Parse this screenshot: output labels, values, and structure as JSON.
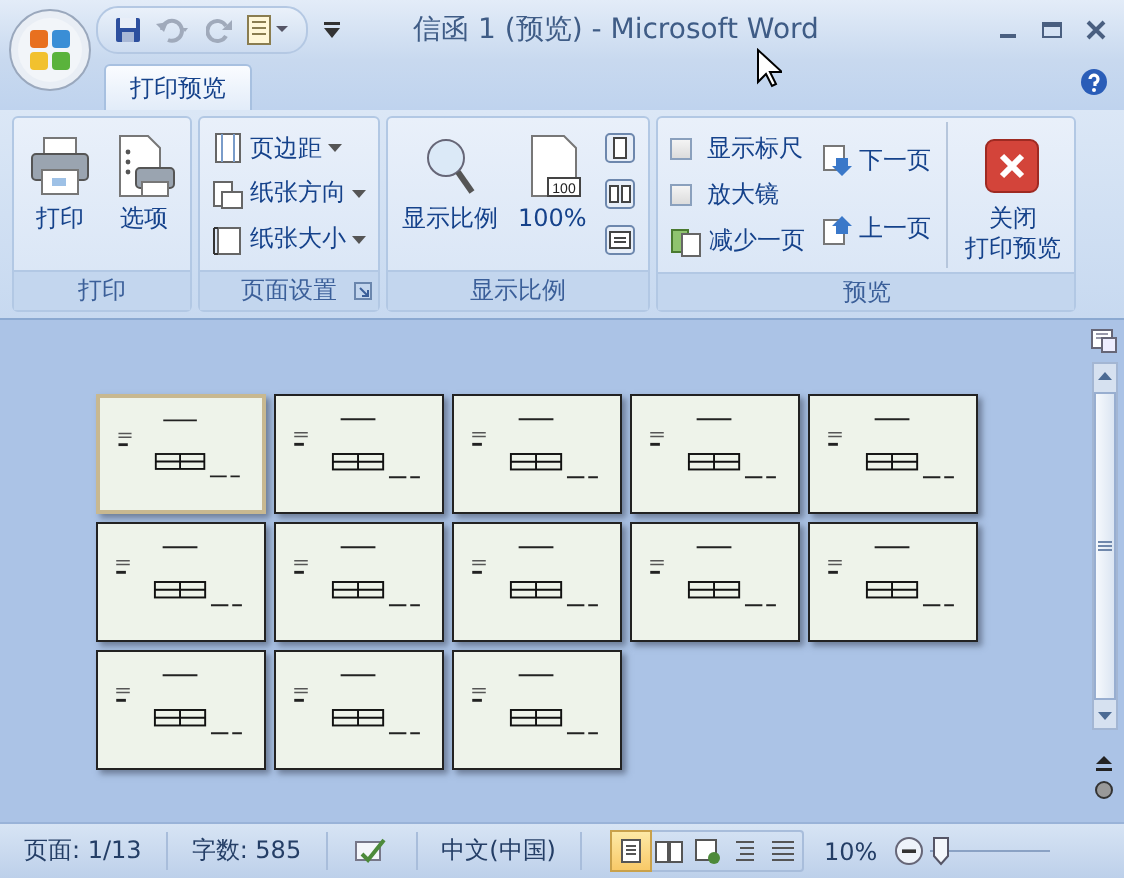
{
  "window": {
    "title": "信函 1 (预览) - Microsoft Word"
  },
  "tabs": [
    {
      "label": "打印预览",
      "selected": true
    }
  ],
  "ribbon": {
    "groups": [
      {
        "label": "打印",
        "dialog_launcher": false,
        "items": [
          {
            "kind": "print",
            "label": "打印"
          },
          {
            "kind": "options",
            "label": "选项"
          }
        ]
      },
      {
        "label": "页面设置",
        "dialog_launcher": true,
        "items": [
          {
            "kind": "margins",
            "label": "页边距"
          },
          {
            "kind": "orientation",
            "label": "纸张方向"
          },
          {
            "kind": "size",
            "label": "纸张大小"
          }
        ]
      },
      {
        "label": "显示比例",
        "dialog_launcher": false,
        "items": [
          {
            "kind": "zoom",
            "label": "显示比例"
          },
          {
            "kind": "hundred",
            "label": "100%",
            "icon_text": "100"
          },
          {
            "kind": "one-page"
          },
          {
            "kind": "two-pages"
          },
          {
            "kind": "page-width"
          }
        ]
      },
      {
        "label": "预览",
        "dialog_launcher": false,
        "items": [
          {
            "kind": "checkbox",
            "label": "显示标尺",
            "checked": false
          },
          {
            "kind": "checkbox",
            "label": "放大镜",
            "checked": false
          },
          {
            "kind": "shrink",
            "label": "减少一页"
          },
          {
            "kind": "next",
            "label": "下一页"
          },
          {
            "kind": "prev",
            "label": "上一页"
          },
          {
            "kind": "close",
            "label": [
              "关闭",
              "打印预览"
            ]
          }
        ]
      }
    ]
  },
  "pages": [
    {
      "selected": true
    },
    {
      "selected": false
    },
    {
      "selected": false
    },
    {
      "selected": false
    },
    {
      "selected": false
    },
    {
      "selected": false
    },
    {
      "selected": false
    },
    {
      "selected": false
    },
    {
      "selected": false
    },
    {
      "selected": false
    },
    {
      "selected": false
    },
    {
      "selected": false
    },
    {
      "selected": false
    }
  ],
  "status_bar": {
    "page": "页面: 1/13",
    "words": "字数: 585",
    "language": "中文(中国)",
    "views": [
      {
        "kind": "print-layout",
        "selected": true
      },
      {
        "kind": "reading",
        "selected": false
      },
      {
        "kind": "web",
        "selected": false
      },
      {
        "kind": "outline",
        "selected": false
      },
      {
        "kind": "draft",
        "selected": false
      }
    ],
    "zoom": {
      "reading": "10%",
      "level": 0.03
    }
  }
}
